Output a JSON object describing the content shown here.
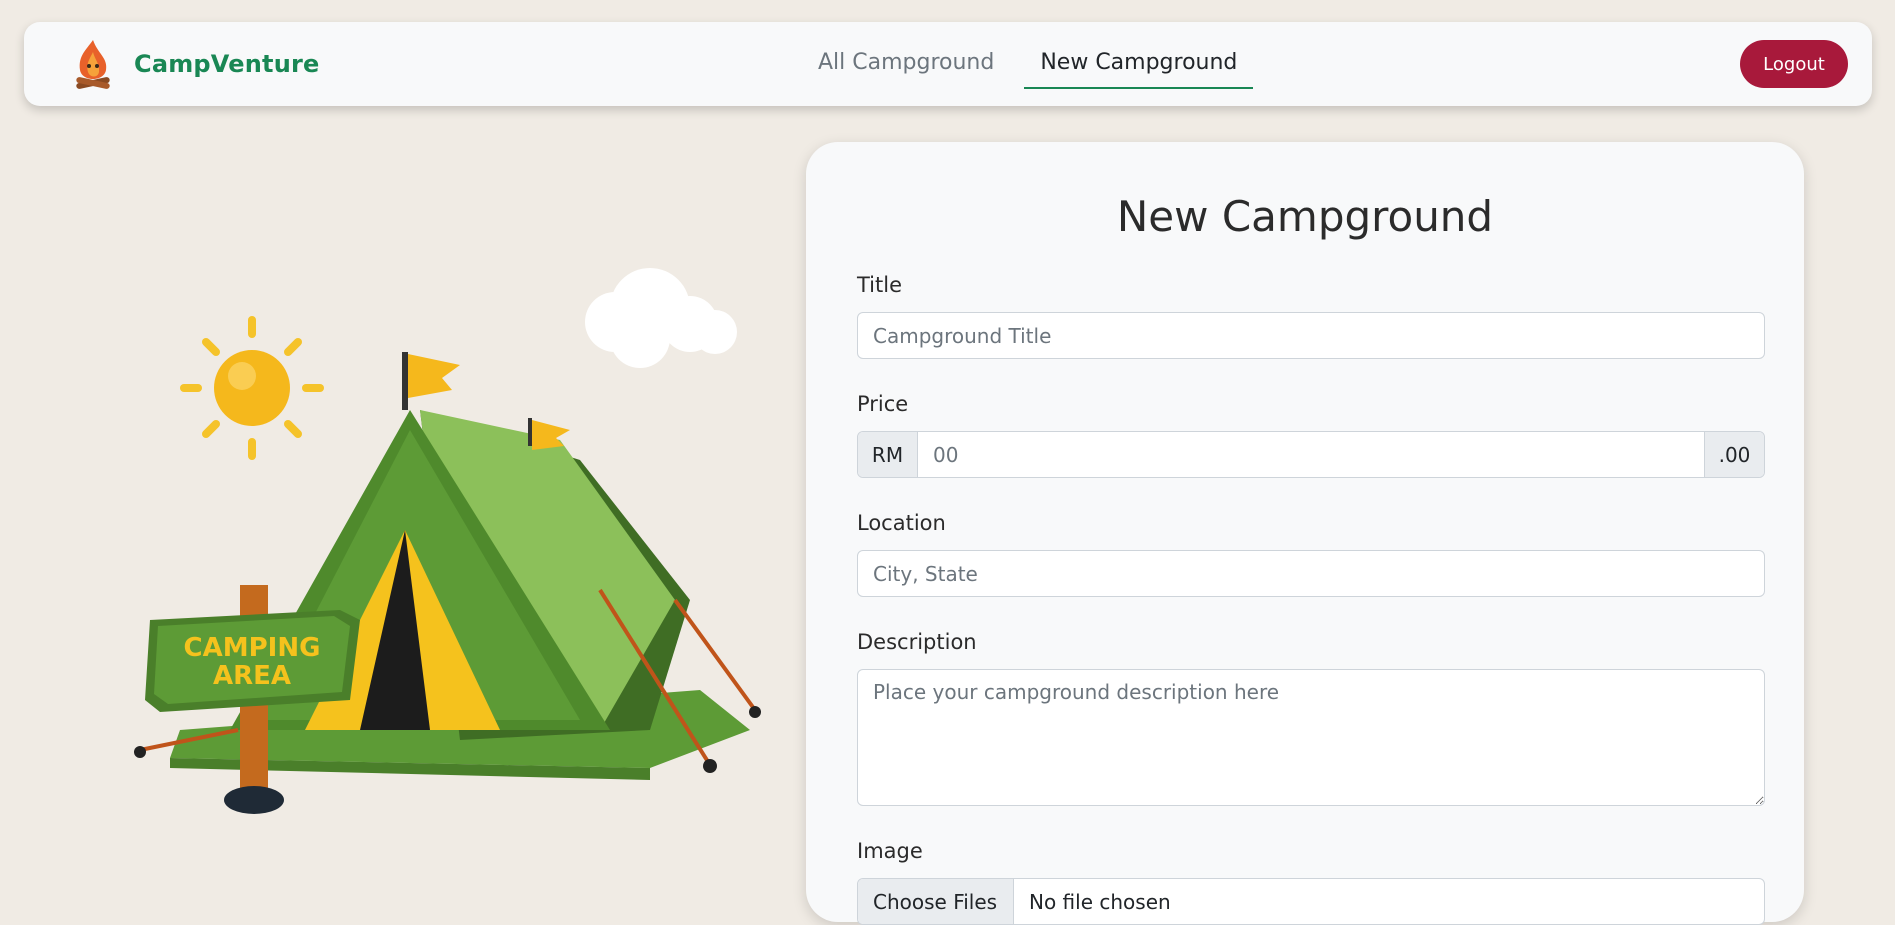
{
  "brand": {
    "name": "CampVenture"
  },
  "nav": {
    "links": [
      {
        "label": "All Campground"
      },
      {
        "label": "New Campground"
      }
    ],
    "logout_label": "Logout"
  },
  "illustration": {
    "sign_line1": "CAMPING",
    "sign_line2": "AREA"
  },
  "form": {
    "title": "New Campground",
    "title_label": "Title",
    "title_placeholder": "Campground Title",
    "price_label": "Price",
    "price_prefix": "RM",
    "price_placeholder": "00",
    "price_suffix": ".00",
    "location_label": "Location",
    "location_placeholder": "City, State",
    "description_label": "Description",
    "description_placeholder": "Place your campground description here",
    "image_label": "Image",
    "file_button": "Choose Files",
    "file_status": "No file chosen"
  },
  "colors": {
    "brand": "#198754",
    "logout": "#a8193b",
    "background": "#f0ebe4"
  }
}
